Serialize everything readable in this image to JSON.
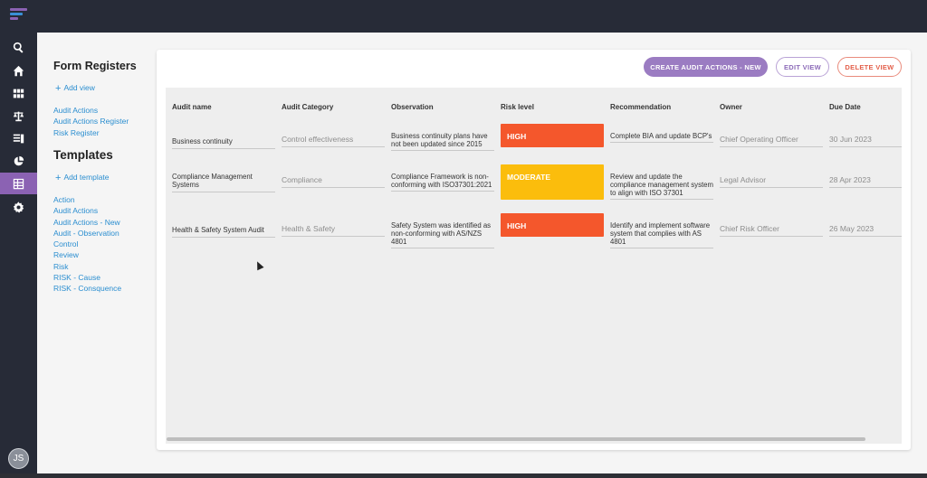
{
  "user": {
    "initials": "JS"
  },
  "left_panel": {
    "form_registers_title": "Form Registers",
    "add_view": "Add view",
    "registers": [
      "Audit Actions",
      "Audit Actions Register",
      "Risk Register"
    ],
    "templates_title": "Templates",
    "add_template": "Add template",
    "templates": [
      "Action",
      "Audit Actions",
      "Audit Actions - New",
      "Audit - Observation",
      "Control",
      "Review",
      "Risk",
      "RISK - Cause",
      "RISK - Consquence"
    ]
  },
  "toolbar": {
    "create_label": "CREATE AUDIT ACTIONS - NEW",
    "edit_label": "EDIT VIEW",
    "delete_label": "DELETE VIEW"
  },
  "table": {
    "headers": [
      "Audit name",
      "Audit Category",
      "Observation",
      "Risk level",
      "Recommendation",
      "Owner",
      "Due Date"
    ],
    "rows": [
      {
        "audit_name": "Business continuity",
        "category": "Control effectiveness",
        "observation": "Business continuity plans have not been updated since 2015",
        "risk": "HIGH",
        "recommendation": "Complete BIA and update BCP's",
        "owner": "Chief Operating Officer",
        "due": "30 Jun 2023"
      },
      {
        "audit_name": "Compliance Management Systems",
        "category": "Compliance",
        "observation": "Compliance Framework is non-conforming with ISO37301:2021",
        "risk": "MODERATE",
        "recommendation": "Review and update the compliance management system to align with ISO 37301",
        "owner": "Legal Advisor",
        "due": "28 Apr 2023"
      },
      {
        "audit_name": "Health & Safety System Audit",
        "category": "Health & Safety",
        "observation": "Safety System was identified as non-conforming with AS/NZS 4801",
        "risk": "HIGH",
        "recommendation": "Identify and implement software system that complies with AS 4801",
        "owner": "Chief Risk Officer",
        "due": "26 May 2023"
      }
    ]
  },
  "colors": {
    "risk_high": "#f4572c",
    "risk_moderate": "#fbbd0c",
    "accent": "#9b7cc2",
    "link": "#2b8ed0"
  },
  "icons": {
    "rail": [
      "search-icon",
      "home-icon",
      "grid-icon",
      "scales-icon",
      "list-icon",
      "pie-chart-icon",
      "table-icon",
      "gear-icon"
    ]
  }
}
